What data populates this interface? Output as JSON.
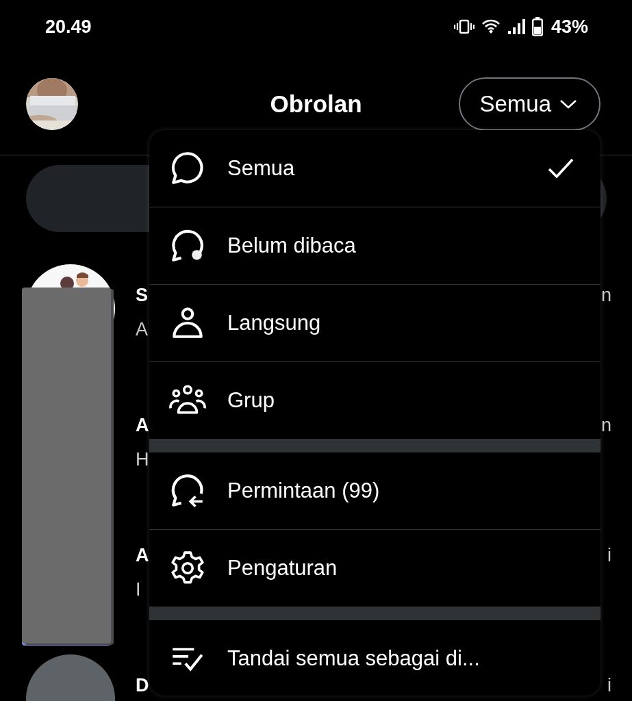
{
  "status_bar": {
    "time": "20.49",
    "battery": "43%"
  },
  "header": {
    "title": "Obrolan",
    "filter_button": "Semua"
  },
  "conversations": [
    {
      "name": "S",
      "preview": "A",
      "time": "n",
      "kind": "picture"
    },
    {
      "name": "A",
      "preview": "H",
      "time": "n"
    },
    {
      "name": "A",
      "preview": "I",
      "time": "i"
    },
    {
      "name": "D",
      "time": "i",
      "kind": "blank"
    }
  ],
  "menu": {
    "sections": [
      [
        {
          "kind": "chat",
          "label": "Semua",
          "selected": true
        },
        {
          "kind": "unread",
          "label": "Belum dibaca",
          "selected": false
        },
        {
          "kind": "person",
          "label": "Langsung",
          "selected": false
        },
        {
          "kind": "group",
          "label": "Grup",
          "selected": false
        }
      ],
      [
        {
          "kind": "requests",
          "label": "Permintaan (99)",
          "selected": false
        },
        {
          "kind": "settings",
          "label": "Pengaturan",
          "selected": false
        }
      ],
      [
        {
          "kind": "mark_read",
          "label": "Tandai semua sebagai di...",
          "selected": false
        }
      ]
    ]
  }
}
